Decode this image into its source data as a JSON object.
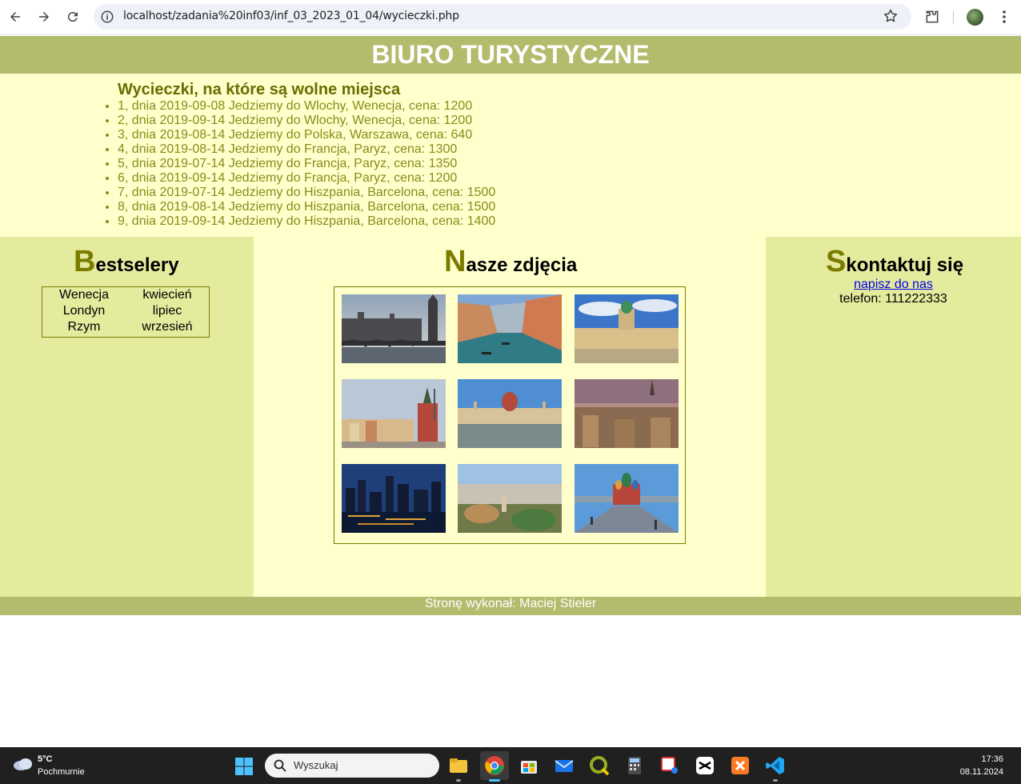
{
  "browser": {
    "url": "localhost/zadania%20inf03/inf_03_2023_01_04/wycieczki.php"
  },
  "page": {
    "banner_title": "BIURO TURYSTYCZNE",
    "trips": {
      "heading": "Wycieczki, na które są wolne miejsca",
      "items": [
        "1, dnia 2019-09-08 Jedziemy do Wlochy, Wenecja, cena: 1200",
        "2, dnia 2019-09-14 Jedziemy do Wlochy, Wenecja, cena: 1200",
        "3, dnia 2019-08-14 Jedziemy do Polska, Warszawa, cena: 640",
        "4, dnia 2019-08-14 Jedziemy do Francja, Paryz, cena: 1300",
        "5, dnia 2019-07-14 Jedziemy do Francja, Paryz, cena: 1350",
        "6, dnia 2019-09-14 Jedziemy do Francja, Paryz, cena: 1200",
        "7, dnia 2019-07-14 Jedziemy do Hiszpania, Barcelona, cena: 1500",
        "8, dnia 2019-08-14 Jedziemy do Hiszpania, Barcelona, cena: 1500",
        "9, dnia 2019-09-14 Jedziemy do Hiszpania, Barcelona, cena: 1400"
      ]
    },
    "bestsellers": {
      "title_first": "B",
      "title_rest": "estselery",
      "rows": [
        {
          "city": "Wenecja",
          "month": "kwiecień"
        },
        {
          "city": "Londyn",
          "month": "lipiec"
        },
        {
          "city": "Rzym",
          "month": "wrzesień"
        }
      ]
    },
    "gallery": {
      "title_first": "N",
      "title_rest": "asze zdjęcia",
      "photos": [
        "london-photo",
        "venice-photo",
        "berlin-palace-photo",
        "warsaw-photo",
        "budapest-photo",
        "paris-photo",
        "new-york-photo",
        "barcelona-photo",
        "moscow-photo"
      ]
    },
    "contact": {
      "title_first": "S",
      "title_rest": "kontaktuj się",
      "link_text": "napisz do nas",
      "phone": "telefon: 111222333"
    },
    "footer": "Stronę wykonał: Maciej Stieler"
  },
  "taskbar": {
    "weather_temp": "5°C",
    "weather_desc": "Pochmurnie",
    "search_placeholder": "Wyszukaj",
    "time": "17:36",
    "date": "08.11.2024"
  },
  "colors": {
    "banner": "#b3bc6d",
    "light_bg": "#ffffcc",
    "side_bg": "#e4eb9d",
    "accent_text": "#7b7b00"
  }
}
